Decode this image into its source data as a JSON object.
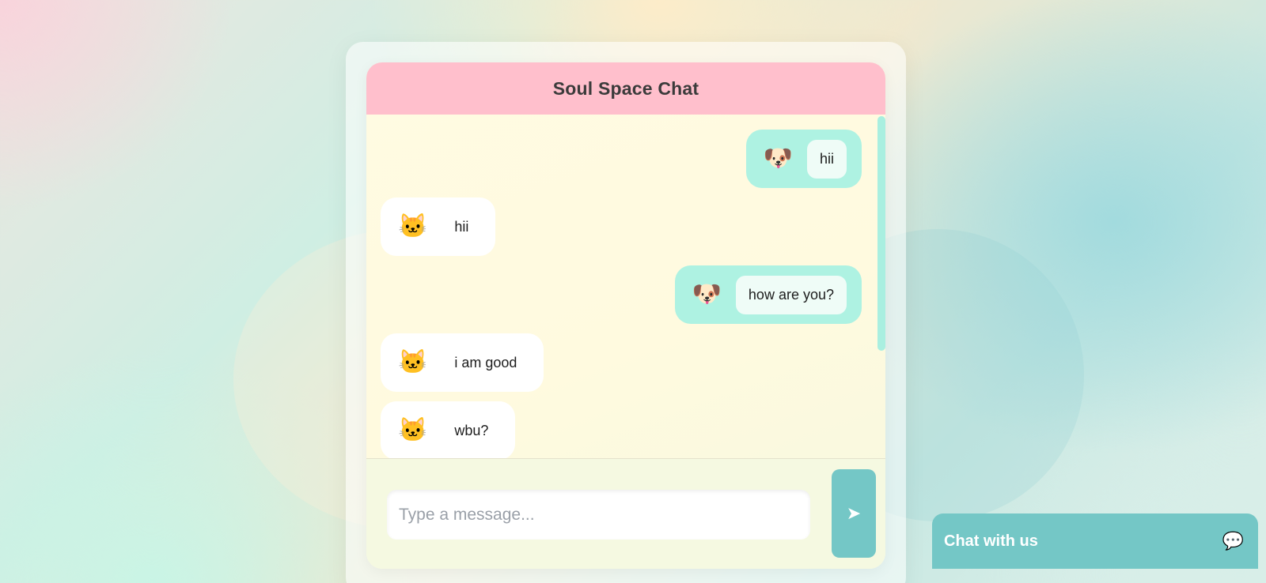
{
  "header": {
    "title": "Soul Space Chat"
  },
  "messages": [
    {
      "side": "sent",
      "avatar": "🐶",
      "text": "hii"
    },
    {
      "side": "recv",
      "avatar": "🐱",
      "text": "hii"
    },
    {
      "side": "sent",
      "avatar": "🐶",
      "text": "how are you?"
    },
    {
      "side": "recv",
      "avatar": "🐱",
      "text": "i am good"
    },
    {
      "side": "recv",
      "avatar": "🐱",
      "text": "wbu?"
    }
  ],
  "composer": {
    "placeholder": "Type a message...",
    "send_icon": "➤"
  },
  "widget": {
    "label": "Chat with us",
    "icon": "💬"
  },
  "colors": {
    "header": "#ffbfcc",
    "accent": "#74c7c6",
    "sent_bubble": "#aef2e2"
  }
}
